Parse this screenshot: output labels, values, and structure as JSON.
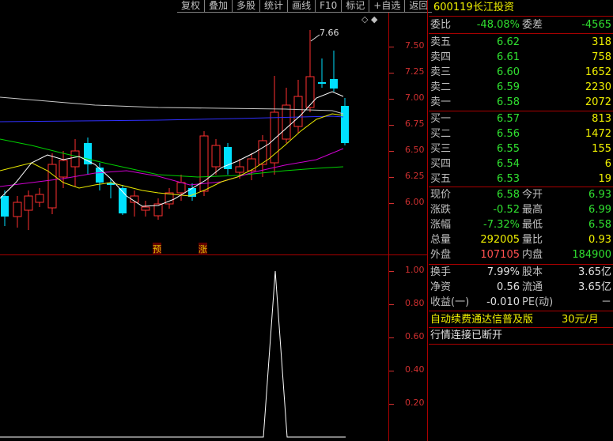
{
  "toolbar": {
    "items": [
      "复权",
      "叠加",
      "多股",
      "统计",
      "画线",
      "F10",
      "标记",
      "+自选",
      "返回"
    ]
  },
  "main_chart": {
    "y_labels": [
      "7.50",
      "7.25",
      "7.00",
      "6.75",
      "6.50",
      "6.25",
      "6.00"
    ],
    "high_label": "7.66",
    "marker_yu": "预",
    "marker_zhang": "涨",
    "diamond_icons": "◇ ◆"
  },
  "sub_chart": {
    "y_labels": [
      "1.00",
      "0.80",
      "0.60",
      "0.40",
      "0.20"
    ]
  },
  "stock": {
    "code": "600119",
    "name": "长江投资"
  },
  "order_ratio": {
    "label": "委比",
    "value": "-48.08%",
    "diff_label": "委差",
    "diff_value": "-4565"
  },
  "asks": [
    {
      "label": "卖五",
      "price": "6.62",
      "vol": "318"
    },
    {
      "label": "卖四",
      "price": "6.61",
      "vol": "758"
    },
    {
      "label": "卖三",
      "price": "6.60",
      "vol": "1652"
    },
    {
      "label": "卖二",
      "price": "6.59",
      "vol": "2230"
    },
    {
      "label": "卖一",
      "price": "6.58",
      "vol": "2072"
    }
  ],
  "bids": [
    {
      "label": "买一",
      "price": "6.57",
      "vol": "813"
    },
    {
      "label": "买二",
      "price": "6.56",
      "vol": "1472"
    },
    {
      "label": "买三",
      "price": "6.55",
      "vol": "155"
    },
    {
      "label": "买四",
      "price": "6.54",
      "vol": "6"
    },
    {
      "label": "买五",
      "price": "6.53",
      "vol": "19"
    }
  ],
  "quote": [
    {
      "l1": "现价",
      "v1": "6.58",
      "c1": "green",
      "l2": "今开",
      "v2": "6.93",
      "c2": "green"
    },
    {
      "l1": "涨跌",
      "v1": "-0.52",
      "c1": "green",
      "l2": "最高",
      "v2": "6.99",
      "c2": "green"
    },
    {
      "l1": "涨幅",
      "v1": "-7.32%",
      "c1": "green",
      "l2": "最低",
      "v2": "6.58",
      "c2": "green"
    },
    {
      "l1": "总量",
      "v1": "292005",
      "c1": "yellow",
      "l2": "量比",
      "v2": "0.93",
      "c2": "yellow"
    },
    {
      "l1": "外盘",
      "v1": "107105",
      "c1": "red",
      "l2": "内盘",
      "v2": "184900",
      "c2": "green"
    }
  ],
  "finance": [
    {
      "l1": "换手",
      "v1": "7.99%",
      "l2": "股本",
      "v2": "3.65亿"
    },
    {
      "l1": "净资",
      "v1": "0.56",
      "l2": "流通",
      "v2": "3.65亿"
    },
    {
      "l1": "收益(一)",
      "v1": "-0.010",
      "l2": "PE(动)",
      "v2": "－"
    }
  ],
  "promo": {
    "text": "自动续费通达信普及版",
    "price": "30元/月"
  },
  "status": {
    "text": "行情连接已断开"
  },
  "colors": {
    "up": "#ff3030",
    "down": "#00e0ff",
    "frame": "#a00000",
    "ma5": "#ffffff",
    "ma10": "#ffff00",
    "ma20": "#ff00ff",
    "ma60": "#00ff00",
    "ma120": "#0000ff"
  }
}
